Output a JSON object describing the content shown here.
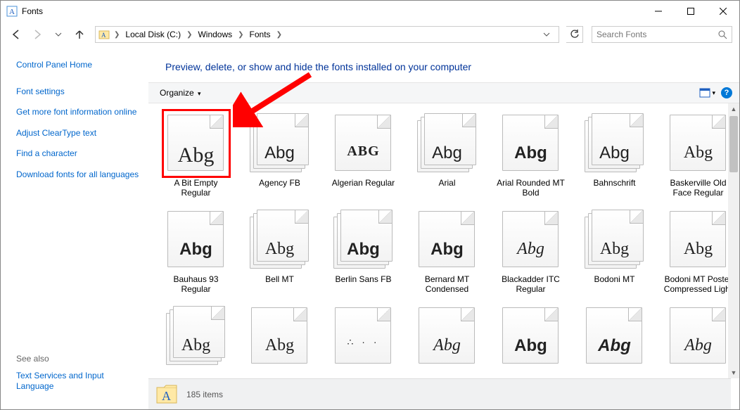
{
  "window": {
    "title": "Fonts"
  },
  "breadcrumbs": [
    "Local Disk (C:)",
    "Windows",
    "Fonts"
  ],
  "search": {
    "placeholder": "Search Fonts"
  },
  "sidebar": {
    "home": "Control Panel Home",
    "links": [
      "Font settings",
      "Get more font information online",
      "Adjust ClearType text",
      "Find a character",
      "Download fonts for all languages"
    ],
    "see_also_label": "See also",
    "see_also_links": [
      "Text Services and Input Language"
    ]
  },
  "heading": "Preview, delete, or show and hide the fonts installed on your computer",
  "toolbar": {
    "organize": "Organize"
  },
  "fonts": [
    {
      "label": "A Bit Empty Regular",
      "sample": "Abg",
      "stack": false,
      "selected": true,
      "style": "font-family:serif;font-size:30px;"
    },
    {
      "label": "Agency FB",
      "sample": "Abg",
      "stack": true,
      "style": "font-family:'Arial Narrow',sans-serif;font-stretch:condensed;"
    },
    {
      "label": "Algerian Regular",
      "sample": "ABG",
      "stack": false,
      "style": "font-family:serif;font-weight:bold;letter-spacing:1px;font-size:20px;"
    },
    {
      "label": "Arial",
      "sample": "Abg",
      "stack": true,
      "style": "font-family:Arial,sans-serif;"
    },
    {
      "label": "Arial Rounded MT Bold",
      "sample": "Abg",
      "stack": false,
      "style": "font-family:Arial,sans-serif;font-weight:900;"
    },
    {
      "label": "Bahnschrift",
      "sample": "Abg",
      "stack": true,
      "style": "font-family:Arial,sans-serif;"
    },
    {
      "label": "Baskerville Old Face Regular",
      "sample": "Abg",
      "stack": false,
      "style": "font-family:Georgia,serif;"
    },
    {
      "label": "Bauhaus 93 Regular",
      "sample": "Abg",
      "stack": false,
      "style": "font-family:Arial,sans-serif;font-weight:900;"
    },
    {
      "label": "Bell MT",
      "sample": "Abg",
      "stack": true,
      "style": "font-family:Georgia,serif;"
    },
    {
      "label": "Berlin Sans FB",
      "sample": "Abg",
      "stack": true,
      "style": "font-family:Arial,sans-serif;font-weight:bold;"
    },
    {
      "label": "Bernard MT Condensed",
      "sample": "Abg",
      "stack": false,
      "style": "font-family:Arial,sans-serif;font-weight:900;font-stretch:condensed;"
    },
    {
      "label": "Blackadder ITC Regular",
      "sample": "Abg",
      "stack": false,
      "style": "font-family:cursive;font-style:italic;"
    },
    {
      "label": "Bodoni MT",
      "sample": "Abg",
      "stack": true,
      "style": "font-family:Georgia,serif;"
    },
    {
      "label": "Bodoni MT Poster Compressed Light",
      "sample": "Abg",
      "stack": false,
      "style": "font-family:Georgia,serif;font-stretch:condensed;"
    },
    {
      "label": "",
      "sample": "Abg",
      "stack": true,
      "style": "font-family:Georgia,serif;"
    },
    {
      "label": "",
      "sample": "Abg",
      "stack": false,
      "style": "font-family:Georgia,serif;"
    },
    {
      "label": "",
      "sample": "∴ · ·",
      "stack": false,
      "style": "font-size:14px;letter-spacing:4px;"
    },
    {
      "label": "",
      "sample": "Abg",
      "stack": false,
      "style": "font-family:cursive;font-style:italic;"
    },
    {
      "label": "",
      "sample": "Abg",
      "stack": false,
      "style": "font-family:Arial,sans-serif;font-weight:900;"
    },
    {
      "label": "",
      "sample": "Abg",
      "stack": false,
      "style": "font-family:Arial,sans-serif;font-weight:900;font-style:italic;"
    },
    {
      "label": "",
      "sample": "Abg",
      "stack": false,
      "style": "font-family:cursive;font-style:italic;"
    }
  ],
  "status": {
    "count": "185 items"
  }
}
